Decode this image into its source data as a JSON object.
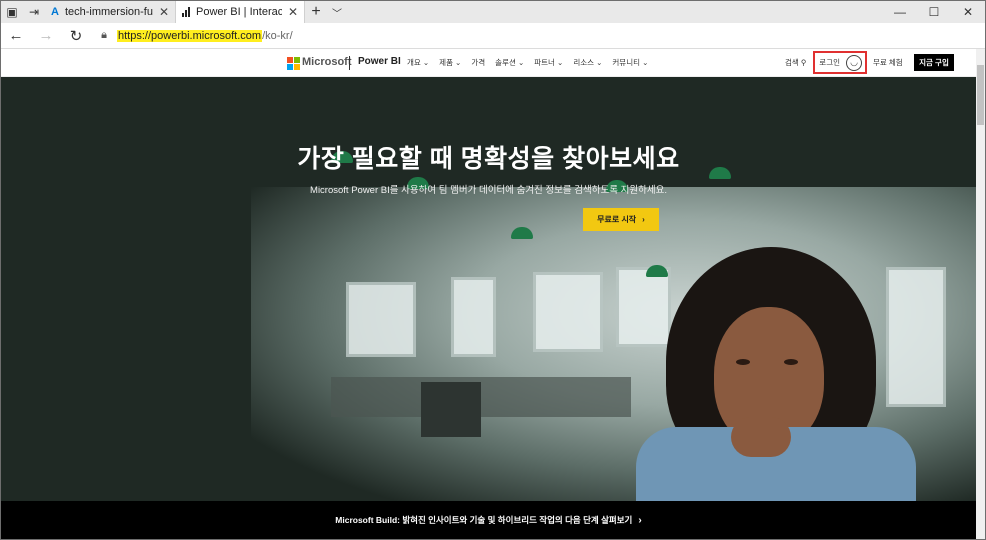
{
  "browser": {
    "tabs": [
      {
        "title": "tech-immersion-functions -",
        "icon": "azure-icon"
      },
      {
        "title": "Power BI | Interactive Da",
        "icon": "powerbi-icon"
      }
    ],
    "url_highlight": "https://powerbi.microsoft.com",
    "url_rest": "/ko-kr/"
  },
  "site_nav": {
    "brand": "Microsoft",
    "product": "Power BI",
    "menu": [
      "개요 ⌄",
      "제품 ⌄",
      "가격",
      "솔루션 ⌄",
      "파트너 ⌄",
      "리소스 ⌄",
      "커뮤니티 ⌄"
    ],
    "search": "검색 ⚲",
    "login": "로그인",
    "free_trial": "무료 체험",
    "buy": "지금 구입"
  },
  "hero": {
    "title": "가장 필요할 때 명확성을 찾아보세요",
    "subtitle": "Microsoft Power BI를 사용하여 팀 멤버가 데이터에 숨겨진 정보를 검색하도록 지원하세요.",
    "cta": "무료로 시작"
  },
  "banner": {
    "text": "Microsoft Build: 밝혀진 인사이트와 기술 및 하이브리드 작업의 다음 단계 살펴보기"
  },
  "colors": {
    "cta": "#f2c811",
    "login_highlight": "#e03030",
    "url_highlight": "#ffee1f",
    "hero_bg": "#1f2924"
  }
}
